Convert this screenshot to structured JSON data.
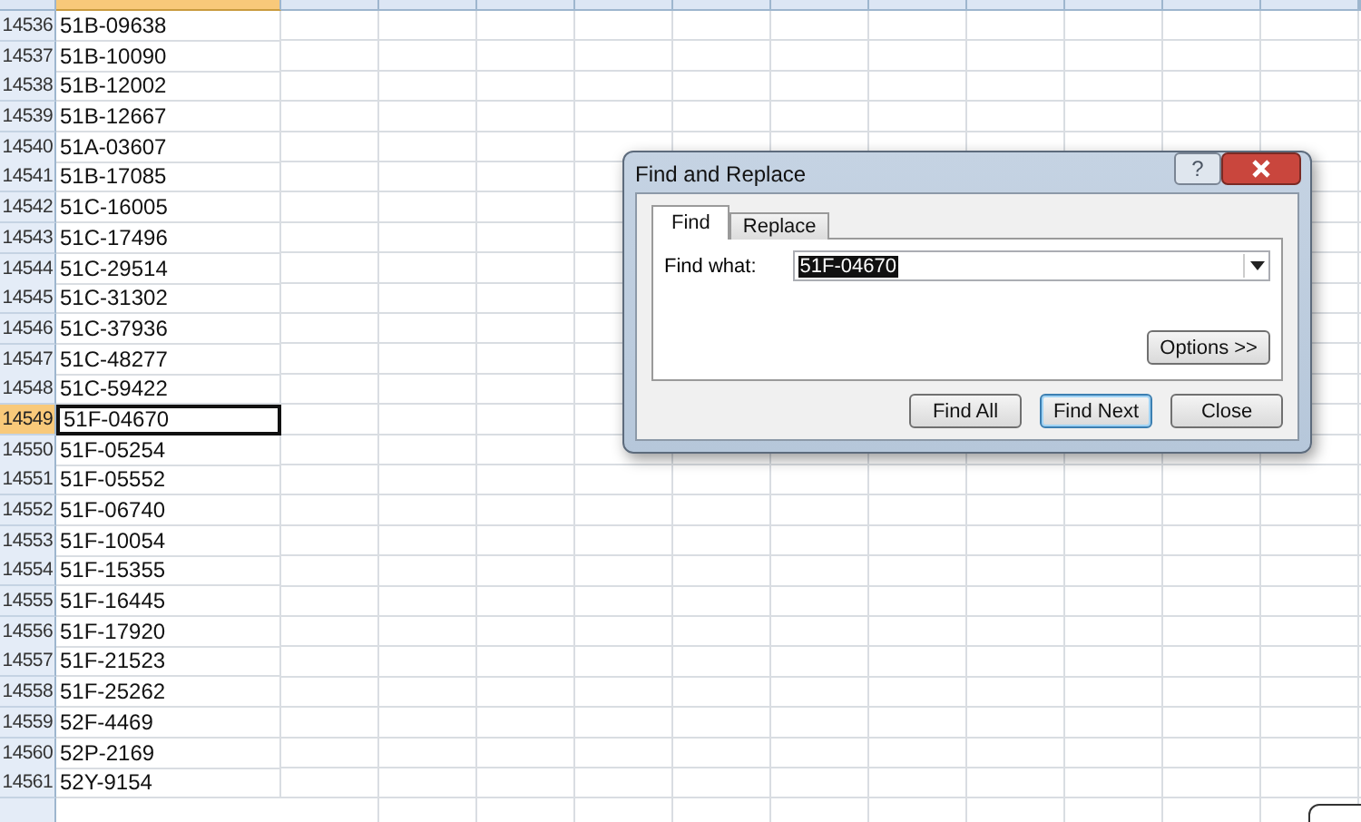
{
  "sheet": {
    "rows": [
      {
        "number": "14536",
        "value": "51B-09638",
        "selected": false
      },
      {
        "number": "14537",
        "value": "51B-10090",
        "selected": false
      },
      {
        "number": "14538",
        "value": "51B-12002",
        "selected": false
      },
      {
        "number": "14539",
        "value": "51B-12667",
        "selected": false
      },
      {
        "number": "14540",
        "value": "51A-03607",
        "selected": false
      },
      {
        "number": "14541",
        "value": "51B-17085",
        "selected": false
      },
      {
        "number": "14542",
        "value": "51C-16005",
        "selected": false
      },
      {
        "number": "14543",
        "value": "51C-17496",
        "selected": false
      },
      {
        "number": "14544",
        "value": "51C-29514",
        "selected": false
      },
      {
        "number": "14545",
        "value": "51C-31302",
        "selected": false
      },
      {
        "number": "14546",
        "value": "51C-37936",
        "selected": false
      },
      {
        "number": "14547",
        "value": "51C-48277",
        "selected": false
      },
      {
        "number": "14548",
        "value": "51C-59422",
        "selected": false
      },
      {
        "number": "14549",
        "value": "51F-04670",
        "selected": true
      },
      {
        "number": "14550",
        "value": "51F-05254",
        "selected": false
      },
      {
        "number": "14551",
        "value": "51F-05552",
        "selected": false
      },
      {
        "number": "14552",
        "value": "51F-06740",
        "selected": false
      },
      {
        "number": "14553",
        "value": "51F-10054",
        "selected": false
      },
      {
        "number": "14554",
        "value": "51F-15355",
        "selected": false
      },
      {
        "number": "14555",
        "value": "51F-16445",
        "selected": false
      },
      {
        "number": "14556",
        "value": "51F-17920",
        "selected": false
      },
      {
        "number": "14557",
        "value": "51F-21523",
        "selected": false
      },
      {
        "number": "14558",
        "value": "51F-25262",
        "selected": false
      },
      {
        "number": "14559",
        "value": "52F-4469",
        "selected": false
      },
      {
        "number": "14560",
        "value": "52P-2169",
        "selected": false
      },
      {
        "number": "14561",
        "value": "52Y-9154",
        "selected": false
      }
    ]
  },
  "dialog": {
    "title": "Find and Replace",
    "help_button": "?",
    "tabs": [
      {
        "label": "Find",
        "selected": true
      },
      {
        "label": "Replace",
        "selected": false
      }
    ],
    "find_what": {
      "label": "Find what:",
      "value": "51F-04670"
    },
    "options_button": "Options >>",
    "buttons": [
      {
        "label": "Find All",
        "default": false
      },
      {
        "label": "Find Next",
        "default": true
      },
      {
        "label": "Close",
        "default": false
      }
    ]
  }
}
